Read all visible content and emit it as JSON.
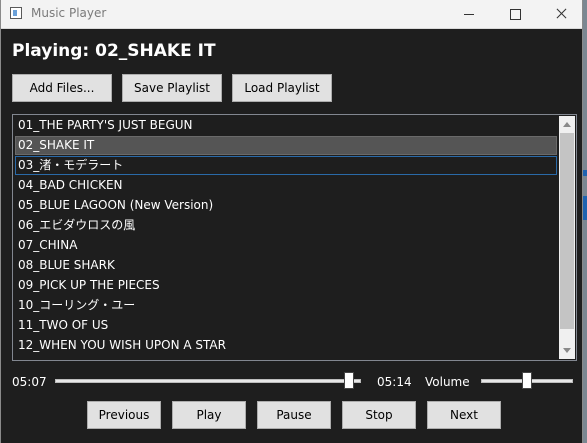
{
  "window": {
    "title": "Music Player"
  },
  "now_playing": {
    "label": "Playing: 02_SHAKE IT"
  },
  "toolbar": {
    "add_files": "Add Files...",
    "save_playlist": "Save Playlist",
    "load_playlist": "Load Playlist"
  },
  "playlist": {
    "tracks": [
      "01_THE PARTY'S JUST BEGUN",
      "02_SHAKE IT",
      "03_渚・モデラート",
      "04_BAD CHICKEN",
      "05_BLUE LAGOON (New Version)",
      "06_エビダウロスの風",
      "07_CHINA",
      "08_BLUE SHARK",
      "09_PICK UP THE PIECES",
      "10_コーリング・ユー",
      "11_TWO OF US",
      "12_WHEN YOU WISH UPON A STAR"
    ],
    "selected_index": 1,
    "focused_index": 2
  },
  "playback": {
    "current_time": "05:07",
    "total_time": "05:14",
    "progress": 0.977
  },
  "volume": {
    "label": "Volume",
    "level": 0.5
  },
  "controls": {
    "previous": "Previous",
    "play": "Play",
    "pause": "Pause",
    "stop": "Stop",
    "next": "Next"
  }
}
